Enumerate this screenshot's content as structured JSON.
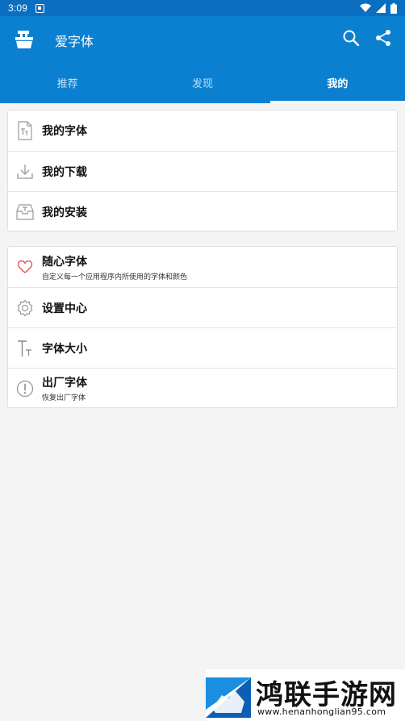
{
  "status_bar": {
    "time": "3:09"
  },
  "app_bar": {
    "title": "爱字体"
  },
  "tabs": [
    {
      "label": "推荐",
      "active": false
    },
    {
      "label": "发现",
      "active": false
    },
    {
      "label": "我的",
      "active": true
    }
  ],
  "section1": {
    "items": [
      {
        "label": "我的字体",
        "icon": "font-file-icon"
      },
      {
        "label": "我的下载",
        "icon": "download-icon"
      },
      {
        "label": "我的安装",
        "icon": "inbox-icon"
      }
    ]
  },
  "section2": {
    "items": [
      {
        "label": "随心字体",
        "subtitle": "自定义每一个应用程序内所使用的字体和颜色",
        "icon": "heart-icon"
      },
      {
        "label": "设置中心",
        "icon": "gear-icon"
      },
      {
        "label": "字体大小",
        "icon": "text-size-icon"
      },
      {
        "label": "出厂字体",
        "subtitle": "恢复出厂字体",
        "icon": "alert-circle-icon"
      }
    ]
  },
  "watermark": {
    "title": "鸿联手游网",
    "url": "www.henanhonglian95.com"
  },
  "colors": {
    "primary": "#0b80d0",
    "status_bar": "#0a6fc0",
    "background": "#f4f4f4",
    "heart": "#e05a5a"
  }
}
